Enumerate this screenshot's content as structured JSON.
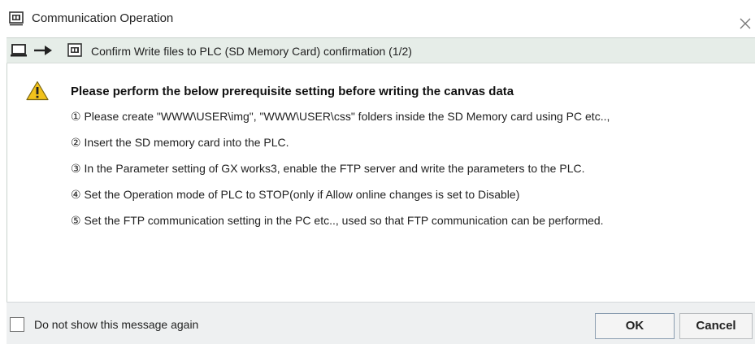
{
  "window": {
    "title": "Communication Operation",
    "title_icon": "plc-icon",
    "close_icon": "close-icon"
  },
  "flow": {
    "source_icon": "pc-icon",
    "arrow_icon": "arrow-right-icon",
    "target_icon": "plc-icon",
    "text": "Confirm Write files to PLC (SD Memory Card) confirmation (1/2)"
  },
  "message": {
    "icon": "warning-icon",
    "title": "Please perform the below prerequisite setting before writing the canvas data",
    "steps": [
      "① Please create \"WWW\\USER\\img\", \"WWW\\USER\\css\" folders inside the SD Memory card using PC etc..,",
      "② Insert the SD memory card into the PLC.",
      "③ In the Parameter setting of GX works3, enable the FTP server and write the parameters to the PLC.",
      "④ Set the Operation mode of PLC to STOP(only if Allow online changes is set to Disable)",
      "⑤ Set the FTP communication setting in the PC etc.., used so that FTP communication can be performed."
    ]
  },
  "footer": {
    "checkbox_label": "Do not show this message again",
    "ok_label": "OK",
    "cancel_label": "Cancel"
  },
  "colors": {
    "flow_bar": "#e6ede8",
    "footer": "#eef0f1",
    "warning_fill": "#f2c21b"
  }
}
